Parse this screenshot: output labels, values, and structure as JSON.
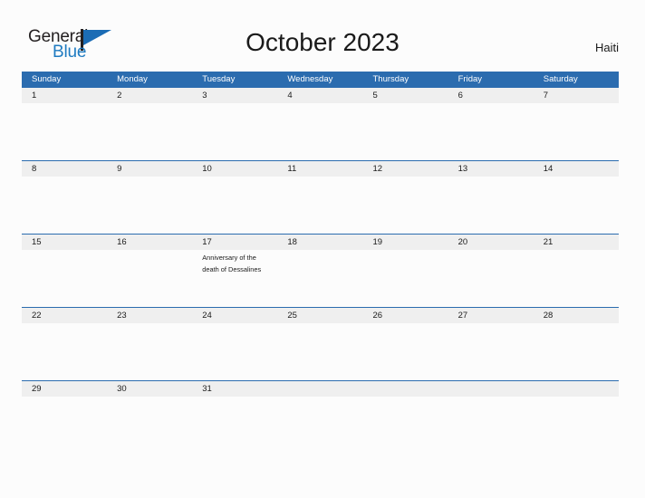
{
  "brand": {
    "name_part1": "General",
    "name_part2": "Blue",
    "flag_icon": "flag-triangle-icon",
    "accent_color": "#1B6CB5"
  },
  "header": {
    "title": "October 2023",
    "country": "Haiti"
  },
  "calendar": {
    "header_bg_color": "#2B6CAF",
    "date_band_color": "#EFEFEF",
    "separator_color": "#2B6CAF",
    "weekdays": [
      "Sunday",
      "Monday",
      "Tuesday",
      "Wednesday",
      "Thursday",
      "Friday",
      "Saturday"
    ],
    "weeks": [
      {
        "days": [
          {
            "date": "1",
            "event": ""
          },
          {
            "date": "2",
            "event": ""
          },
          {
            "date": "3",
            "event": ""
          },
          {
            "date": "4",
            "event": ""
          },
          {
            "date": "5",
            "event": ""
          },
          {
            "date": "6",
            "event": ""
          },
          {
            "date": "7",
            "event": ""
          }
        ]
      },
      {
        "days": [
          {
            "date": "8",
            "event": ""
          },
          {
            "date": "9",
            "event": ""
          },
          {
            "date": "10",
            "event": ""
          },
          {
            "date": "11",
            "event": ""
          },
          {
            "date": "12",
            "event": ""
          },
          {
            "date": "13",
            "event": ""
          },
          {
            "date": "14",
            "event": ""
          }
        ]
      },
      {
        "days": [
          {
            "date": "15",
            "event": ""
          },
          {
            "date": "16",
            "event": ""
          },
          {
            "date": "17",
            "event": "Anniversary of the death of Dessalines"
          },
          {
            "date": "18",
            "event": ""
          },
          {
            "date": "19",
            "event": ""
          },
          {
            "date": "20",
            "event": ""
          },
          {
            "date": "21",
            "event": ""
          }
        ]
      },
      {
        "days": [
          {
            "date": "22",
            "event": ""
          },
          {
            "date": "23",
            "event": ""
          },
          {
            "date": "24",
            "event": ""
          },
          {
            "date": "25",
            "event": ""
          },
          {
            "date": "26",
            "event": ""
          },
          {
            "date": "27",
            "event": ""
          },
          {
            "date": "28",
            "event": ""
          }
        ]
      },
      {
        "days": [
          {
            "date": "29",
            "event": ""
          },
          {
            "date": "30",
            "event": ""
          },
          {
            "date": "31",
            "event": ""
          },
          {
            "date": "",
            "event": ""
          },
          {
            "date": "",
            "event": ""
          },
          {
            "date": "",
            "event": ""
          },
          {
            "date": "",
            "event": ""
          }
        ]
      }
    ]
  }
}
